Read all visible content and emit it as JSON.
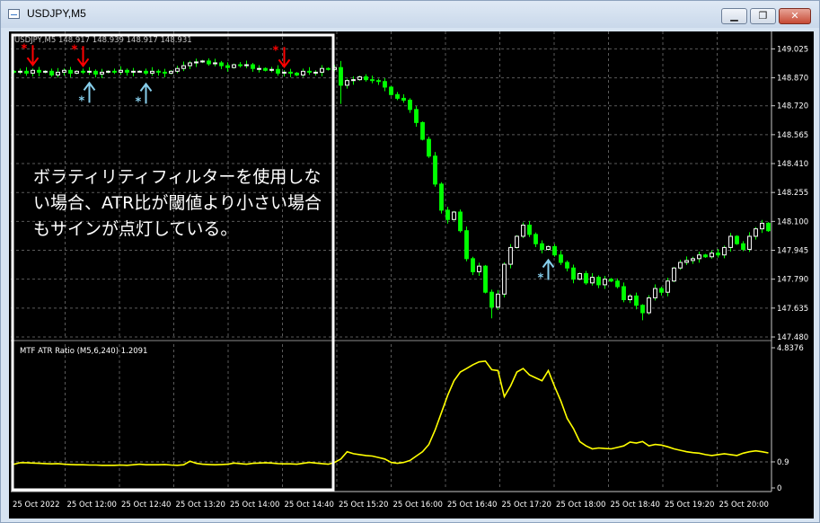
{
  "window": {
    "title": "USDJPY,M5",
    "minimize_label": "▁",
    "maximize_label": "❐",
    "close_label": "✕",
    "icon": "chart-window-icon"
  },
  "main_header": "USDJPY,M5  148.917 148.939 148.917 148.931",
  "indicator_header": "MTF ATR Ratio  (M5,6,240) 1.2091",
  "annotation": "ボラティリティフィルターを使用しない場合、ATR比が閾値より小さい場合もサインが点灯している。",
  "colors": {
    "background": "#000000",
    "grid": "#5a5a5a",
    "bull_candle": "#ffffff",
    "bear_candle": "#00ff00",
    "sell_arrow": "#ff0000",
    "buy_arrow": "#87ceeb",
    "indicator_line": "#ffff00",
    "highlight_box": "#ffffff"
  },
  "chart_data": [
    {
      "type": "candlestick",
      "symbol": "USDJPY",
      "timeframe": "M5",
      "ylim": [
        147.48,
        149.08
      ],
      "y_ticks": [
        "149.025",
        "148.870",
        "148.720",
        "148.565",
        "148.410",
        "148.255",
        "148.100",
        "147.945",
        "147.790",
        "147.635",
        "147.480"
      ],
      "x_ticks": [
        "25 Oct 2022",
        "25 Oct 12:00",
        "25 Oct 12:40",
        "25 Oct 13:20",
        "25 Oct 14:00",
        "25 Oct 14:40",
        "25 Oct 15:20",
        "25 Oct 16:00",
        "25 Oct 16:40",
        "25 Oct 17:20",
        "25 Oct 18:00",
        "25 Oct 18:40",
        "25 Oct 19:20",
        "25 Oct 20:00"
      ],
      "close": [
        148.9,
        148.905,
        148.895,
        148.91,
        148.9,
        148.905,
        148.885,
        148.9,
        148.91,
        148.895,
        148.905,
        148.9,
        148.905,
        148.89,
        148.9,
        148.905,
        148.9,
        148.91,
        148.9,
        148.905,
        148.905,
        148.895,
        148.905,
        148.9,
        148.895,
        148.905,
        148.92,
        148.935,
        148.95,
        148.955,
        148.96,
        148.945,
        148.95,
        148.935,
        148.925,
        148.94,
        148.935,
        148.94,
        148.92,
        148.92,
        148.91,
        148.915,
        148.895,
        148.9,
        148.895,
        148.885,
        148.905,
        148.9,
        148.9,
        148.92,
        148.915,
        148.925,
        148.83,
        148.855,
        148.86,
        148.875,
        148.86,
        148.855,
        148.85,
        148.82,
        148.78,
        148.76,
        148.75,
        148.7,
        148.63,
        148.54,
        148.45,
        148.3,
        148.16,
        148.11,
        148.15,
        148.05,
        147.9,
        147.83,
        147.86,
        147.72,
        147.64,
        147.71,
        147.87,
        147.96,
        148.02,
        148.08,
        148.03,
        147.98,
        147.95,
        147.965,
        147.92,
        147.88,
        147.85,
        147.79,
        147.82,
        147.77,
        147.8,
        147.76,
        147.79,
        147.78,
        147.75,
        147.68,
        147.7,
        147.65,
        147.61,
        147.69,
        147.74,
        147.72,
        147.78,
        147.85,
        147.88,
        147.89,
        147.9,
        147.92,
        147.91,
        147.93,
        147.92,
        147.96,
        148.02,
        147.98,
        147.95,
        148.02,
        148.06,
        148.09,
        148.05
      ],
      "sell_signals": [
        "25 Oct 11:25",
        "25 Oct 12:05",
        "25 Oct 14:45"
      ],
      "buy_signals": [
        "25 Oct 12:10",
        "25 Oct 12:55",
        "25 Oct 18:15"
      ]
    },
    {
      "type": "line",
      "name": "MTF ATR Ratio (M5,6,240)",
      "current_value": 1.2091,
      "ylim": [
        0,
        4.8376
      ],
      "y_ticks": [
        "4.8376",
        "0.9",
        "0"
      ],
      "threshold": 0.9,
      "values": [
        0.82,
        0.87,
        0.87,
        0.86,
        0.85,
        0.84,
        0.83,
        0.84,
        0.82,
        0.81,
        0.8,
        0.8,
        0.79,
        0.79,
        0.78,
        0.78,
        0.78,
        0.79,
        0.78,
        0.8,
        0.82,
        0.8,
        0.8,
        0.8,
        0.81,
        0.79,
        0.78,
        0.8,
        0.92,
        0.85,
        0.82,
        0.81,
        0.8,
        0.81,
        0.82,
        0.86,
        0.84,
        0.82,
        0.85,
        0.86,
        0.87,
        0.86,
        0.84,
        0.83,
        0.83,
        0.82,
        0.85,
        0.88,
        0.86,
        0.84,
        0.82,
        0.88,
        1.0,
        1.25,
        1.18,
        1.15,
        1.12,
        1.1,
        1.05,
        1.0,
        0.88,
        0.85,
        0.88,
        0.95,
        1.1,
        1.25,
        1.5,
        2.0,
        2.6,
        3.2,
        3.7,
        4.0,
        4.12,
        4.25,
        4.35,
        4.38,
        4.08,
        4.05,
        3.15,
        3.52,
        4.0,
        4.12,
        3.9,
        3.8,
        3.7,
        4.05,
        3.5,
        3.0,
        2.4,
        2.05,
        1.6,
        1.45,
        1.35,
        1.38,
        1.36,
        1.35,
        1.4,
        1.45,
        1.58,
        1.55,
        1.6,
        1.45,
        1.5,
        1.48,
        1.42,
        1.35,
        1.3,
        1.25,
        1.22,
        1.2,
        1.15,
        1.12,
        1.15,
        1.18,
        1.15,
        1.12,
        1.2,
        1.25,
        1.28,
        1.25,
        1.2091
      ]
    }
  ]
}
